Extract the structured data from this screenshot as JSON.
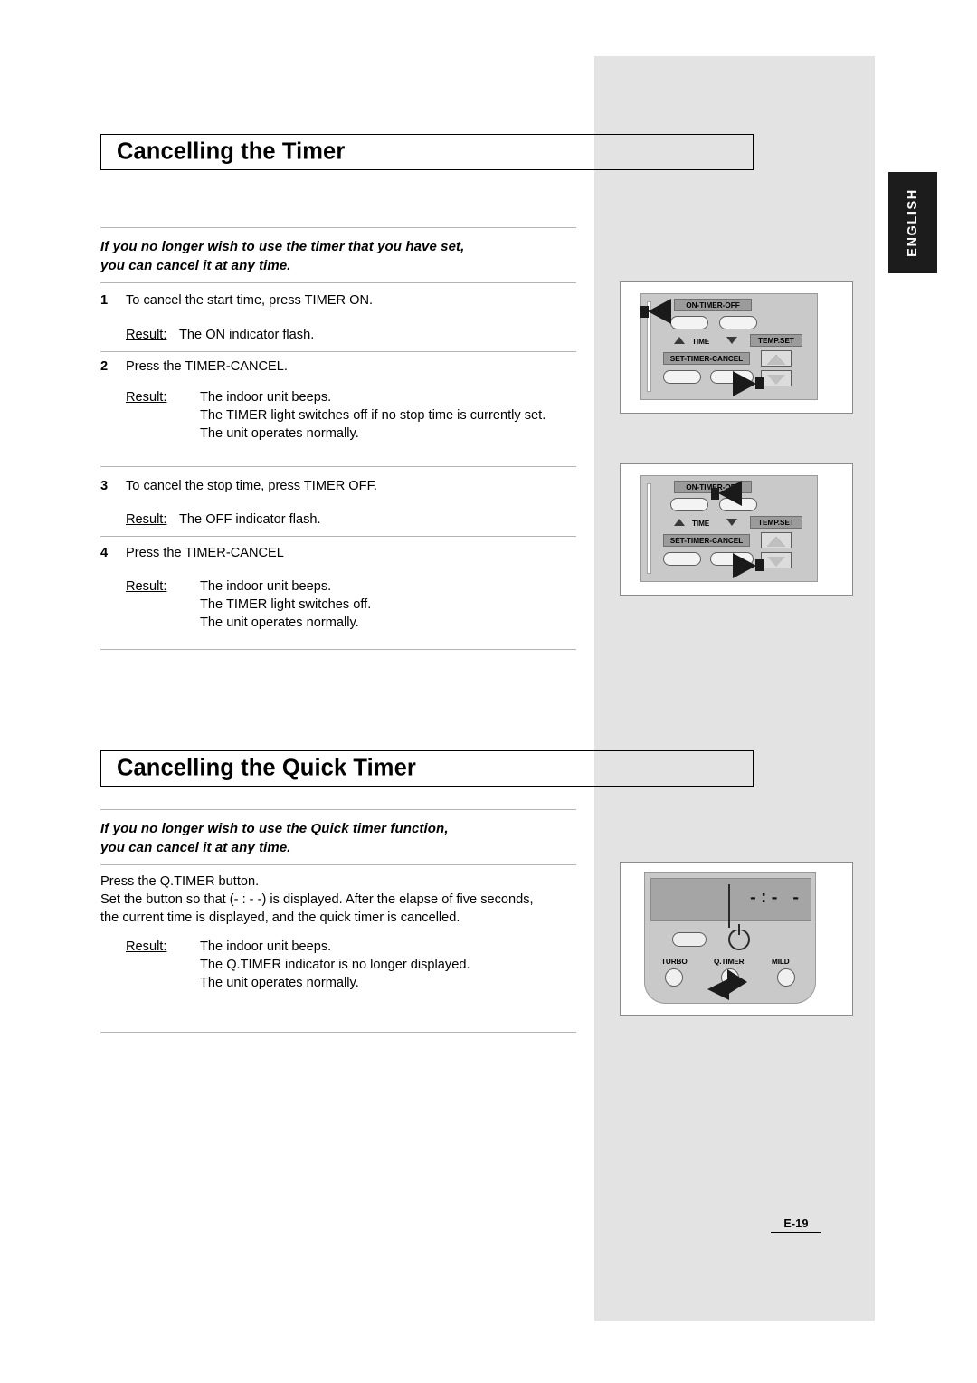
{
  "page": {
    "language_tab": "ENGLISH",
    "footer_page": "E-19"
  },
  "sections": [
    {
      "title": "Cancelling the Timer",
      "intro_line1": "If you no longer wish to use the timer that you have set,",
      "intro_line2": "you can cancel it at any time.",
      "steps": [
        {
          "number": "1",
          "text": "To cancel the start time, press TIMER ON.",
          "result_label": "Result:",
          "result_lines": [
            "The ON indicator flash."
          ]
        },
        {
          "number": "2",
          "text": "Press the TIMER-CANCEL.",
          "result_label": "Result:",
          "result_lines": [
            "The indoor unit beeps.",
            "The TIMER light switches off if no stop time is currently set.",
            "The unit operates normally."
          ]
        },
        {
          "number": "3",
          "text": "To cancel the stop time, press TIMER OFF.",
          "result_label": "Result:",
          "result_lines": [
            "The OFF indicator flash."
          ]
        },
        {
          "number": "4",
          "text": "Press the TIMER-CANCEL",
          "result_label": "Result:",
          "result_lines": [
            "The indoor unit beeps.",
            "The TIMER light switches off.",
            "The unit operates normally."
          ]
        }
      ]
    },
    {
      "title": "Cancelling the Quick Timer",
      "intro_line1": "If you no longer wish to use the Quick timer function,",
      "intro_line2": "you can cancel it at any time.",
      "paragraph_lines": [
        "Press the Q.TIMER button.",
        "Set the button so that (- : - -) is displayed. After the elapse of five seconds,",
        "the current time is displayed, and the quick timer is cancelled."
      ],
      "result_label": "Result:",
      "result_lines": [
        "The indoor unit beeps.",
        "The Q.TIMER indicator is no longer displayed.",
        "The unit operates normally."
      ]
    }
  ],
  "remotes": [
    {
      "id": "remote-timer-on",
      "labels": {
        "on_timer_off": "ON-TIMER-OFF",
        "time": "TIME",
        "temp_set": "TEMP.SET",
        "set_timer_cancel": "SET-TIMER-CANCEL"
      }
    },
    {
      "id": "remote-timer-off",
      "labels": {
        "on_timer_off": "ON-TIMER-OFF",
        "time": "TIME",
        "temp_set": "TEMP.SET",
        "set_timer_cancel": "SET-TIMER-CANCEL"
      }
    },
    {
      "id": "remote-quick-timer",
      "display": "-:- -",
      "labels": {
        "turbo": "TURBO",
        "qtimer": "Q.TIMER",
        "mild": "MILD"
      }
    }
  ]
}
